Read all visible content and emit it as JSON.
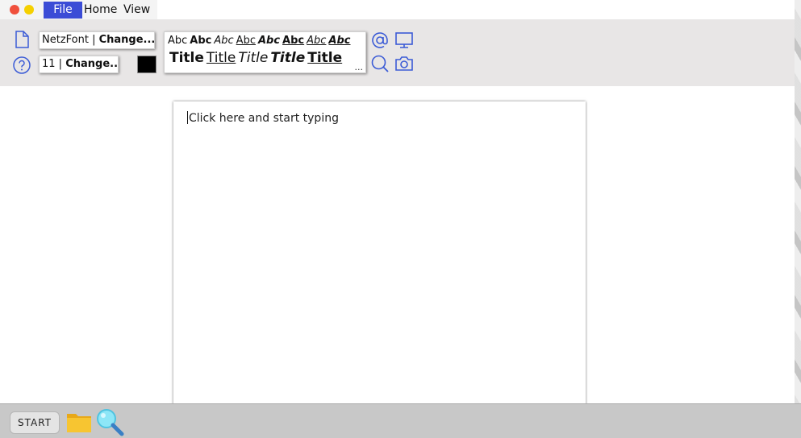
{
  "window": {
    "menu": {
      "file": "File",
      "home": "Home",
      "view": "View"
    }
  },
  "ribbon": {
    "font_field": {
      "name": "NetzFont",
      "separator": " | ",
      "action": "Change..."
    },
    "size_field": {
      "value": "11",
      "separator": " | ",
      "action": "Change..."
    },
    "color_swatch": "#000000",
    "styles": {
      "row1": [
        "Abc",
        "Abc",
        "Abc",
        "Abc",
        "Abc",
        "Abc",
        "Abc",
        "Abc"
      ],
      "row2": [
        "Title",
        "Title",
        "Title",
        "Title",
        "Title"
      ],
      "more": "..."
    },
    "icons": [
      "new-document-icon",
      "help-icon",
      "at-sign-icon",
      "monitor-icon",
      "search-icon",
      "camera-icon"
    ]
  },
  "document": {
    "placeholder": "Click here and start typing"
  },
  "taskbar": {
    "start_label": "START",
    "icons": [
      "folder-icon",
      "magnifier-icon"
    ]
  },
  "colors": {
    "accent": "#3b4cd6",
    "icon_blue": "#3b5bd6",
    "close": "#f0503c",
    "minimize": "#f5d000"
  }
}
